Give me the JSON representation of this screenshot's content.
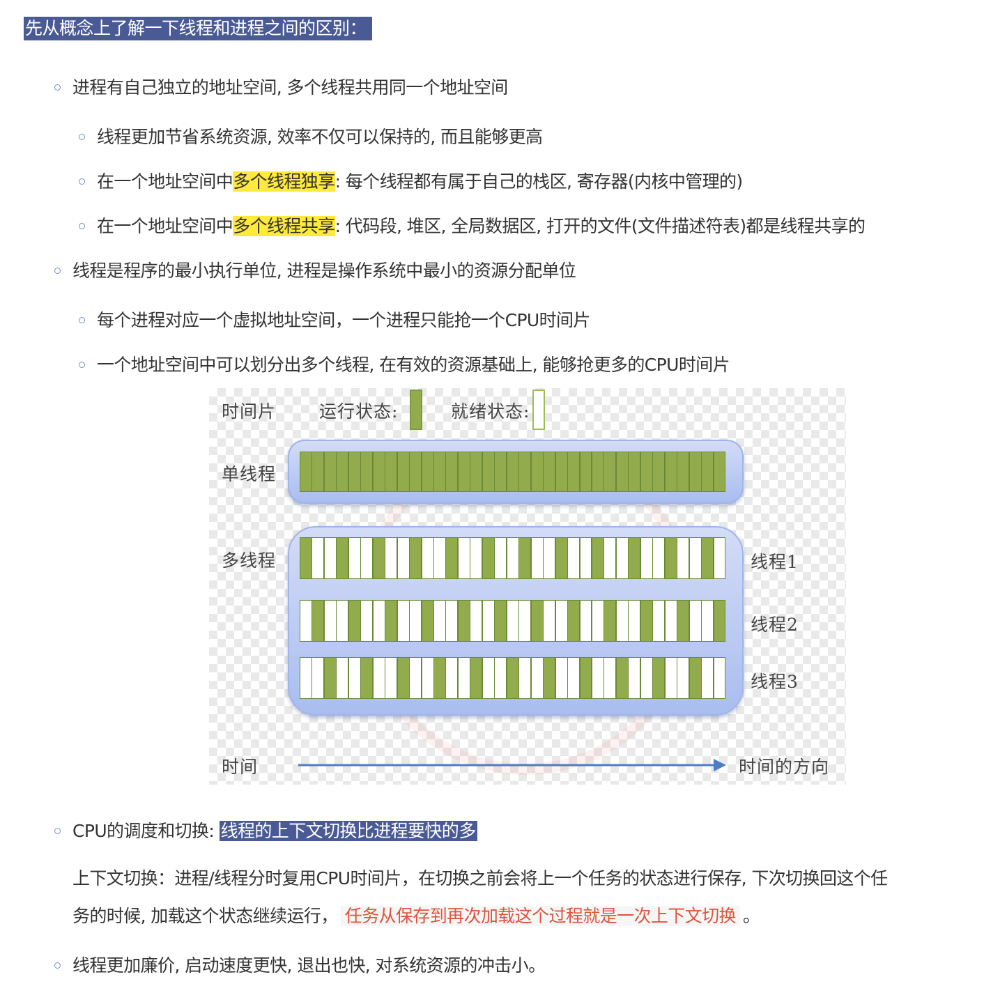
{
  "heading": "先从概念上了解一下线程和进程之间的区别：",
  "list": {
    "item1": "进程有自己独立的地址空间, 多个线程共用同一个地址空间",
    "item1_sub1": "线程更加节省系统资源, 效率不仅可以保持的, 而且能够更高",
    "item1_sub2_pre": "在一个地址空间中",
    "item1_sub2_hl": "多个线程独享",
    "item1_sub2_post": ": 每个线程都有属于自己的栈区, 寄存器(内核中管理的)",
    "item1_sub3_pre": "在一个地址空间中",
    "item1_sub3_hl": "多个线程共享",
    "item1_sub3_post": ": 代码段, 堆区, 全局数据区, 打开的文件(文件描述符表)都是线程共享的",
    "item2": "线程是程序的最小执行单位, 进程是操作系统中最小的资源分配单位",
    "item2_sub1": "每个进程对应一个虚拟地址空间，一个进程只能抢一个CPU时间片",
    "item2_sub2": "一个地址空间中可以划分出多个线程, 在有效的资源基础上, 能够抢更多的CPU时间片",
    "item3_pre": "CPU的调度和切换: ",
    "item3_hl": "线程的上下文切换比进程要快的多",
    "item3_para_line1": "上下文切换：进程/线程分时复用CPU时间片，在切换之前会将上一个任务的状态进行保存, 下次切换回这个任",
    "item3_para_line2_pre": "务的时候, 加载这个状态继续运行，",
    "item3_para_code": "任务从保存到再次加载这个过程就是一次上下文切换",
    "item3_para_line2_post": "。",
    "item4": "线程更加廉价, 启动速度更快, 退出也快, 对系统资源的冲击小。"
  },
  "figure": {
    "time_slice_label": "时间片",
    "running_label": "运行状态:",
    "ready_label": "就绪状态:",
    "single_thread_label": "单线程",
    "multi_thread_label": "多线程",
    "thread1_label": "线程1",
    "thread2_label": "线程2",
    "thread3_label": "线程3",
    "time_label": "时间",
    "time_direction_label": "时间的方向",
    "colors": {
      "running": "#92ab4d",
      "ready": "#ffffff",
      "panel": "#b9c9f2",
      "arrow": "#4f7cc4"
    },
    "slot_count": 35,
    "single_thread_running": [
      1,
      1,
      1,
      1,
      1,
      1,
      1,
      1,
      1,
      1,
      1,
      1,
      1,
      1,
      1,
      1,
      1,
      1,
      1,
      1,
      1,
      1,
      1,
      1,
      1,
      1,
      1,
      1,
      1,
      1,
      1,
      1,
      1,
      1,
      1
    ],
    "thread1_running": [
      1,
      0,
      0,
      1,
      0,
      0,
      1,
      0,
      0,
      1,
      0,
      0,
      1,
      0,
      0,
      1,
      0,
      0,
      1,
      0,
      0,
      1,
      0,
      0,
      1,
      0,
      0,
      1,
      0,
      0,
      1,
      0,
      0,
      1,
      0
    ],
    "thread2_running": [
      0,
      1,
      0,
      0,
      1,
      0,
      0,
      1,
      0,
      0,
      1,
      0,
      0,
      1,
      0,
      0,
      1,
      0,
      0,
      1,
      0,
      0,
      1,
      0,
      0,
      1,
      0,
      0,
      1,
      0,
      0,
      1,
      0,
      0,
      1
    ],
    "thread3_running": [
      0,
      0,
      1,
      0,
      0,
      1,
      0,
      0,
      1,
      0,
      0,
      1,
      0,
      0,
      1,
      0,
      0,
      1,
      0,
      0,
      1,
      0,
      0,
      1,
      0,
      0,
      1,
      0,
      0,
      1,
      0,
      0,
      1,
      0,
      0
    ]
  }
}
